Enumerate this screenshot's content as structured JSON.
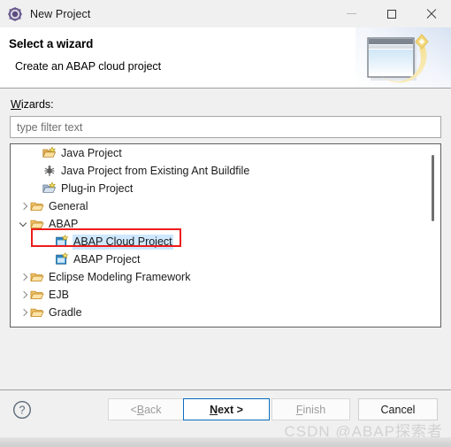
{
  "window": {
    "title": "New Project",
    "icon": "eclipse-wizard-icon",
    "controls": {
      "minimize": "minimize-icon",
      "maximize": "maximize-icon",
      "close": "close-icon"
    }
  },
  "header": {
    "title": "Select a wizard",
    "description": "Create an ABAP cloud project",
    "banner_icon": "wizard-banner-icon"
  },
  "form": {
    "wizards_label_mnemonic": "W",
    "wizards_label_rest": "izards:",
    "filter": {
      "placeholder": "type filter text",
      "value": ""
    }
  },
  "tree": {
    "items": [
      {
        "label": "Java Project",
        "indent": 1,
        "arrow": "none",
        "icon": "java-project-icon",
        "selected": false
      },
      {
        "label": "Java Project from Existing Ant Buildfile",
        "indent": 1,
        "arrow": "none",
        "icon": "ant-buildfile-icon",
        "selected": false
      },
      {
        "label": "Plug-in Project",
        "indent": 1,
        "arrow": "none",
        "icon": "plugin-project-icon",
        "selected": false
      },
      {
        "label": "General",
        "indent": 0,
        "arrow": "collapsed",
        "icon": "folder-icon",
        "selected": false
      },
      {
        "label": "ABAP",
        "indent": 0,
        "arrow": "expanded",
        "icon": "folder-icon",
        "selected": false
      },
      {
        "label": "ABAP Cloud Project",
        "indent": 2,
        "arrow": "none",
        "icon": "abap-project-icon",
        "selected": true
      },
      {
        "label": "ABAP Project",
        "indent": 2,
        "arrow": "none",
        "icon": "abap-project-icon",
        "selected": false
      },
      {
        "label": "Eclipse Modeling Framework",
        "indent": 0,
        "arrow": "collapsed",
        "icon": "folder-icon",
        "selected": false
      },
      {
        "label": "EJB",
        "indent": 0,
        "arrow": "collapsed",
        "icon": "folder-icon",
        "selected": false
      },
      {
        "label": "Gradle",
        "indent": 0,
        "arrow": "collapsed",
        "icon": "folder-icon",
        "selected": false
      }
    ],
    "scrollbar": "vertical-scrollbar"
  },
  "annotation": {
    "target": "ABAP Cloud Project",
    "color": "#ee1c1c"
  },
  "footer": {
    "help": "help-icon",
    "buttons": [
      {
        "id": "back",
        "prefix": "< ",
        "mnemonic": "B",
        "suffix": "ack",
        "disabled": true,
        "default": false
      },
      {
        "id": "next",
        "prefix": "",
        "mnemonic": "N",
        "suffix": "ext >",
        "disabled": false,
        "default": true
      },
      {
        "id": "finish",
        "prefix": "",
        "mnemonic": "F",
        "suffix": "inish",
        "disabled": true,
        "default": false
      },
      {
        "id": "cancel",
        "prefix": "",
        "mnemonic": "",
        "suffix": "Cancel",
        "disabled": false,
        "default": false
      }
    ]
  },
  "watermark": {
    "text": "CSDN @ABAP探索者"
  },
  "colors": {
    "selection": "#cde8ff",
    "annotation": "#ee1c1c",
    "default_button_border": "#0b6cbf",
    "window_bg": "#f0f0f0"
  }
}
